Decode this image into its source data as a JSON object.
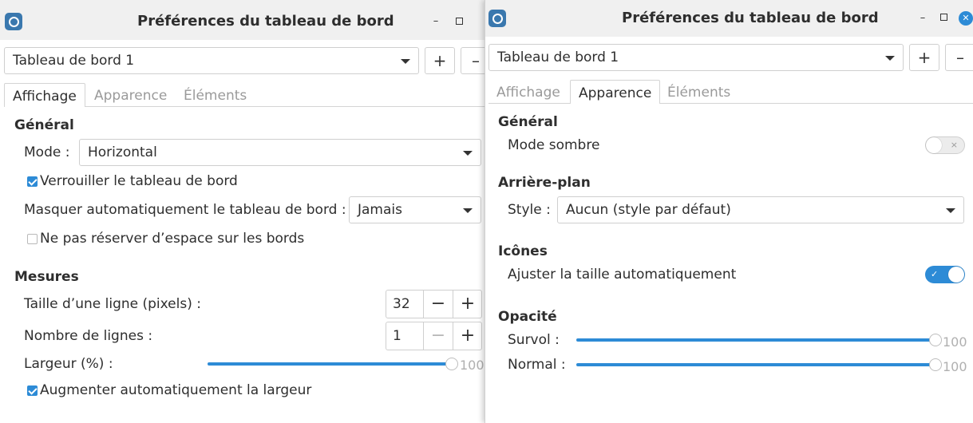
{
  "left_window": {
    "title": "Préférences du tableau de bord",
    "controls": {
      "minimize": "–",
      "add": "+",
      "remove": "–"
    },
    "panel_select": "Tableau de bord 1",
    "tabs": [
      {
        "label": "Affichage",
        "active": true
      },
      {
        "label": "Apparence",
        "active": false
      },
      {
        "label": "Éléments",
        "active": false
      }
    ],
    "general": {
      "heading": "Général",
      "mode_label": "Mode :",
      "mode_value": "Horizontal",
      "lock_label": "Verrouiller le tableau de bord",
      "lock_checked": true,
      "autohide_label": "Masquer automatiquement le tableau de bord :",
      "autohide_value": "Jamais",
      "reserve_label": "Ne pas réserver d’espace sur les bords",
      "reserve_checked": false
    },
    "measures": {
      "heading": "Mesures",
      "row_size_label": "Taille d’une ligne (pixels) :",
      "row_size_value": "32",
      "rows_label": "Nombre de lignes :",
      "rows_value": "1",
      "width_label": "Largeur (%) :",
      "width_value": "100",
      "autowidth_label": "Augmenter automatiquement la largeur",
      "autowidth_checked": true,
      "minus": "−",
      "plus": "+"
    }
  },
  "right_window": {
    "title": "Préférences du tableau de bord",
    "controls": {
      "minimize": "–",
      "close": "✕",
      "add": "+",
      "remove": "–"
    },
    "panel_select": "Tableau de bord 1",
    "tabs": [
      {
        "label": "Affichage",
        "active": false
      },
      {
        "label": "Apparence",
        "active": true
      },
      {
        "label": "Éléments",
        "active": false
      }
    ],
    "general": {
      "heading": "Général",
      "dark_mode_label": "Mode sombre",
      "dark_mode_on": false,
      "off_mark": "×"
    },
    "background": {
      "heading": "Arrière-plan",
      "style_label": "Style :",
      "style_value": "Aucun (style par défaut)"
    },
    "icons": {
      "heading": "Icônes",
      "autosize_label": "Ajuster la taille automatiquement",
      "autosize_on": true,
      "on_mark": "✓"
    },
    "opacity": {
      "heading": "Opacité",
      "hover_label": "Survol :",
      "hover_value": "100",
      "normal_label": "Normal :",
      "normal_value": "100"
    }
  },
  "colors": {
    "accent": "#2d8bd6",
    "dim_text": "#9a9a9a",
    "titlebar": "#f0f0f0"
  }
}
